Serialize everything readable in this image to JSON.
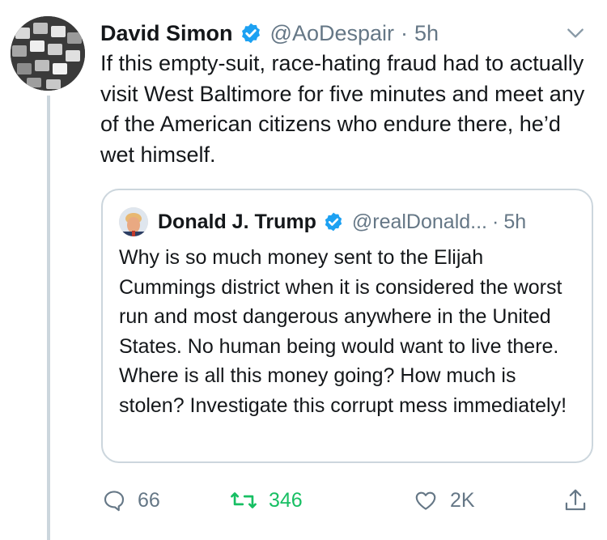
{
  "tweet": {
    "author_name": "David Simon",
    "handle": "@AoDespair",
    "separator": "·",
    "time": "5h",
    "text": "If this empty-suit, race-hating fraud had to actually visit West Baltimore for five minutes and meet any of the American citizens who endure there, he’d wet himself."
  },
  "quoted_tweet": {
    "author_name": "Donald J. Trump",
    "handle": "@realDonald...",
    "separator": "·",
    "time": "5h",
    "text": "Why is so much money sent to the Elijah Cummings district when it is considered the worst run and most dangerous anywhere in the United States. No human being would want to live there. Where is all this money going? How much is stolen? Investigate this corrupt mess immediately!"
  },
  "actions": {
    "replies": "66",
    "retweets": "346",
    "likes": "2K"
  },
  "colors": {
    "verified": "#1da1f2",
    "retweet_active": "#17bf63",
    "muted": "#657786",
    "border": "#ccd6dd"
  },
  "icons": [
    "verified-badge-icon",
    "chevron-down-icon",
    "reply-icon",
    "retweet-icon",
    "like-icon",
    "share-icon"
  ]
}
